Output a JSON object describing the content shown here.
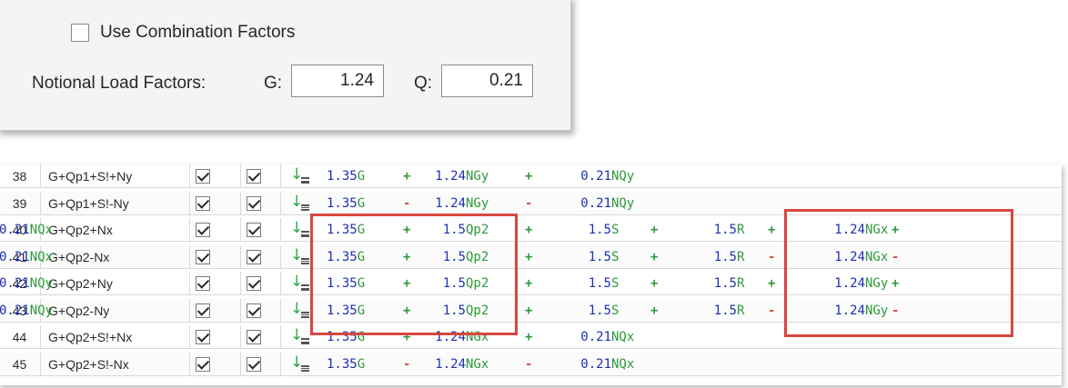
{
  "options": {
    "use_combination_factors": {
      "label": "Use Combination Factors",
      "checked": false
    },
    "notional_label": "Notional Load Factors:",
    "g_label": "G:",
    "g_value": "1.24",
    "q_label": "Q:",
    "q_value": "0.21"
  },
  "rows": [
    {
      "id": "38",
      "name": "G+Qp1+S!+Ny",
      "chk1": true,
      "chk2": true,
      "t": [
        {
          "v": "1.35",
          "u": "G"
        },
        {
          "op": "+"
        },
        {
          "v": "1.24",
          "u": "NGy"
        },
        {
          "op": "+"
        },
        {
          "v": "0.21",
          "u": "NQy"
        }
      ]
    },
    {
      "id": "39",
      "name": "G+Qp1+S!-Ny",
      "chk1": true,
      "chk2": true,
      "t": [
        {
          "v": "1.35",
          "u": "G"
        },
        {
          "op": "-"
        },
        {
          "v": "1.24",
          "u": "NGy"
        },
        {
          "op": "-"
        },
        {
          "v": "0.21",
          "u": "NQy"
        }
      ]
    },
    {
      "id": "40",
      "name": "G+Qp2+Nx",
      "chk1": true,
      "chk2": true,
      "t": [
        {
          "v": "1.35",
          "u": "G"
        },
        {
          "op": "+"
        },
        {
          "v": "1.5",
          "u": "Qp2"
        },
        {
          "op": "+"
        },
        {
          "v": "1.5",
          "u": "S"
        },
        {
          "op": "+"
        },
        {
          "v": "1.5",
          "u": "R"
        },
        {
          "op": "+"
        },
        {
          "v": "1.24",
          "u": "NGx"
        },
        {
          "op": "+"
        },
        {
          "v": "0.21",
          "u": "NQx"
        }
      ]
    },
    {
      "id": "41",
      "name": "G+Qp2-Nx",
      "chk1": true,
      "chk2": true,
      "t": [
        {
          "v": "1.35",
          "u": "G"
        },
        {
          "op": "+"
        },
        {
          "v": "1.5",
          "u": "Qp2"
        },
        {
          "op": "+"
        },
        {
          "v": "1.5",
          "u": "S"
        },
        {
          "op": "+"
        },
        {
          "v": "1.5",
          "u": "R"
        },
        {
          "op": "-"
        },
        {
          "v": "1.24",
          "u": "NGx"
        },
        {
          "op": "-"
        },
        {
          "v": "0.21",
          "u": "NQx"
        }
      ]
    },
    {
      "id": "42",
      "name": "G+Qp2+Ny",
      "chk1": true,
      "chk2": true,
      "t": [
        {
          "v": "1.35",
          "u": "G"
        },
        {
          "op": "+"
        },
        {
          "v": "1.5",
          "u": "Qp2"
        },
        {
          "op": "+"
        },
        {
          "v": "1.5",
          "u": "S"
        },
        {
          "op": "+"
        },
        {
          "v": "1.5",
          "u": "R"
        },
        {
          "op": "+"
        },
        {
          "v": "1.24",
          "u": "NGy"
        },
        {
          "op": "+"
        },
        {
          "v": "0.21",
          "u": "NQy"
        }
      ]
    },
    {
      "id": "43",
      "name": "G+Qp2-Ny",
      "chk1": true,
      "chk2": true,
      "t": [
        {
          "v": "1.35",
          "u": "G"
        },
        {
          "op": "+"
        },
        {
          "v": "1.5",
          "u": "Qp2"
        },
        {
          "op": "+"
        },
        {
          "v": "1.5",
          "u": "S"
        },
        {
          "op": "+"
        },
        {
          "v": "1.5",
          "u": "R"
        },
        {
          "op": "-"
        },
        {
          "v": "1.24",
          "u": "NGy"
        },
        {
          "op": "-"
        },
        {
          "v": "0.21",
          "u": "NQy"
        }
      ]
    },
    {
      "id": "44",
      "name": "G+Qp2+S!+Nx",
      "chk1": true,
      "chk2": true,
      "t": [
        {
          "v": "1.35",
          "u": "G"
        },
        {
          "op": "+"
        },
        {
          "v": "1.24",
          "u": "NGx"
        },
        {
          "op": "+"
        },
        {
          "v": "0.21",
          "u": "NQx"
        }
      ]
    },
    {
      "id": "45",
      "name": "G+Qp2+S!-Nx",
      "chk1": true,
      "chk2": true,
      "t": [
        {
          "v": "1.35",
          "u": "G"
        },
        {
          "op": "-"
        },
        {
          "v": "1.24",
          "u": "NGx"
        },
        {
          "op": "-"
        },
        {
          "v": "0.21",
          "u": "NQx"
        }
      ]
    }
  ],
  "colors": {
    "value": "#1f2fb0",
    "unit": "#2e9a3a",
    "plus": "#2e9a3a",
    "minus": "#d9534f",
    "highlight": "#d7473f"
  }
}
